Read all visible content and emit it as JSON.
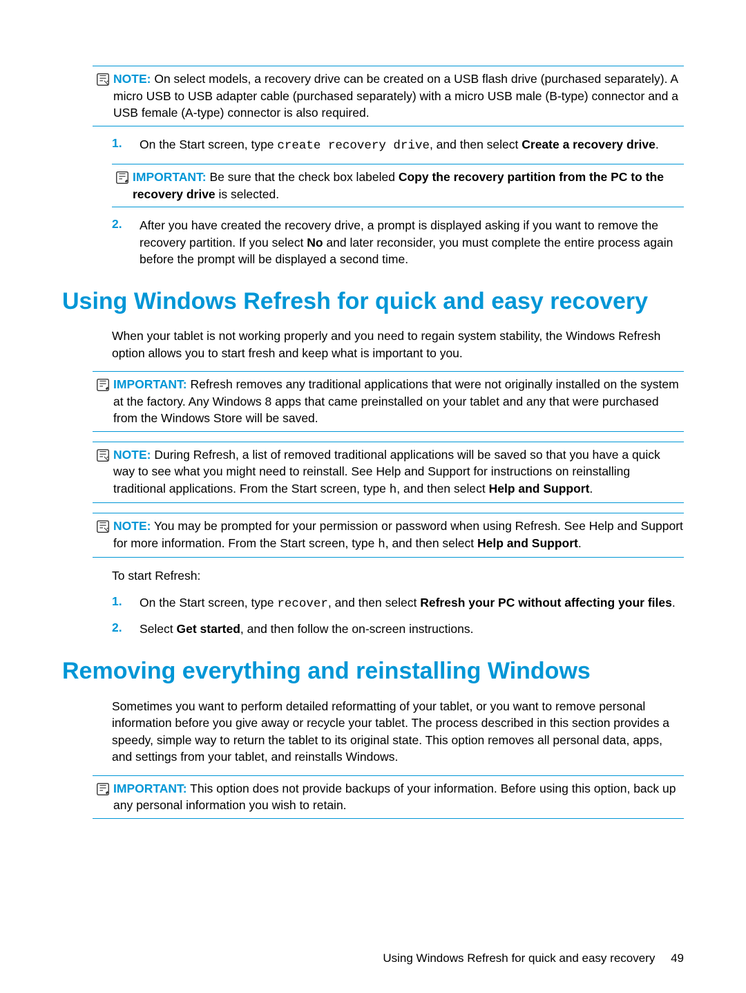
{
  "callout1": {
    "label": "NOTE:",
    "text_before": "On select models, a recovery drive can be created on a USB flash drive (purchased separately). A micro USB to USB adapter cable (purchased separately) with a micro USB male (B-type) connector and a USB female (A-type) connector is also required."
  },
  "list1": {
    "item1_num": "1.",
    "item1_a": "On the Start screen, type ",
    "item1_code": "create recovery drive",
    "item1_b": ", and then select ",
    "item1_bold": "Create a recovery drive",
    "item1_c": ".",
    "item2_num": "2.",
    "item2_a": "After you have created the recovery drive, a prompt is displayed asking if you want to remove the recovery partition. If you select ",
    "item2_bold": "No",
    "item2_b": " and later reconsider, you must complete the entire process again before the prompt will be displayed a second time."
  },
  "callout2": {
    "label": "IMPORTANT:",
    "text_a": "Be sure that the check box labeled ",
    "bold": "Copy the recovery partition from the PC to the recovery drive",
    "text_b": " is selected."
  },
  "heading1": "Using Windows Refresh for quick and easy recovery",
  "para1": "When your tablet is not working properly and you need to regain system stability, the Windows Refresh option allows you to start fresh and keep what is important to you.",
  "callout3": {
    "label": "IMPORTANT:",
    "text": "Refresh removes any traditional applications that were not originally installed on the system at the factory. Any Windows 8 apps that came preinstalled on your tablet and any that were purchased from the Windows Store will be saved."
  },
  "callout4": {
    "label": "NOTE:",
    "text_a": "During Refresh, a list of removed traditional applications will be saved so that you have a quick way to see what you might need to reinstall. See Help and Support for instructions on reinstalling traditional applications. From the Start screen, type ",
    "code": "h",
    "text_b": ", and then select ",
    "bold": "Help and Support",
    "text_c": "."
  },
  "callout5": {
    "label": "NOTE:",
    "text_a": "You may be prompted for your permission or password when using Refresh. See Help and Support for more information. From the Start screen, type ",
    "code": "h",
    "text_b": ", and then select ",
    "bold": "Help and Support",
    "text_c": "."
  },
  "para2": "To start Refresh:",
  "list2": {
    "item1_num": "1.",
    "item1_a": "On the Start screen, type ",
    "item1_code": "recover",
    "item1_b": ", and then select ",
    "item1_bold": "Refresh your PC without affecting your files",
    "item1_c": ".",
    "item2_num": "2.",
    "item2_a": "Select ",
    "item2_bold": "Get started",
    "item2_b": ", and then follow the on-screen instructions."
  },
  "heading2": "Removing everything and reinstalling Windows",
  "para3": "Sometimes you want to perform detailed reformatting of your tablet, or you want to remove personal information before you give away or recycle your tablet. The process described in this section provides a speedy, simple way to return the tablet to its original state. This option removes all personal data, apps, and settings from your tablet, and reinstalls Windows.",
  "callout6": {
    "label": "IMPORTANT:",
    "text": "This option does not provide backups of your information. Before using this option, back up any personal information you wish to retain."
  },
  "footer": {
    "title": "Using Windows Refresh for quick and easy recovery",
    "page": "49"
  }
}
